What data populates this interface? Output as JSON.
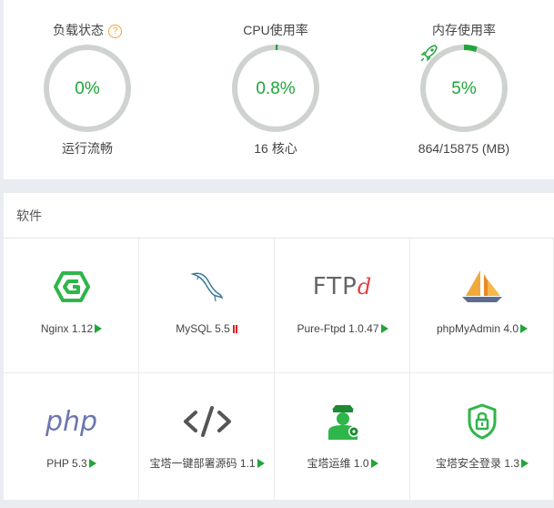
{
  "gauges": [
    {
      "title": "负载状态",
      "value_text": "0%",
      "percent": 0,
      "subtitle": "运行流畅",
      "help_icon": "help-icon"
    },
    {
      "title": "CPU使用率",
      "value_text": "0.8%",
      "percent": 0.8,
      "subtitle": "16 核心"
    },
    {
      "title": "内存使用率",
      "value_text": "5%",
      "percent": 5,
      "subtitle": "864/15875 (MB)",
      "icon": "rocket-icon"
    }
  ],
  "colors": {
    "accent": "#20a53a",
    "ring": "#cfd3cf",
    "stopped": "#e02020",
    "help": "#f0a22f"
  },
  "software": {
    "header": "软件",
    "items": [
      {
        "name": "Nginx 1.12",
        "status": "running",
        "icon": "nginx-icon"
      },
      {
        "name": "MySQL 5.5",
        "status": "stopped",
        "icon": "mysql-dolphin-icon"
      },
      {
        "name": "Pure-Ftpd 1.0.47",
        "status": "running",
        "icon": "ftp-icon",
        "logo_text": "FTP",
        "logo_d": "d"
      },
      {
        "name": "phpMyAdmin 4.0",
        "status": "running",
        "icon": "phpmyadmin-sailboat-icon"
      },
      {
        "name": "PHP 5.3",
        "status": "running",
        "icon": "php-icon",
        "logo_text": "php"
      },
      {
        "name": "宝塔一键部署源码 1.1",
        "status": "running",
        "icon": "code-icon"
      },
      {
        "name": "宝塔运维 1.0",
        "status": "running",
        "icon": "ops-person-icon"
      },
      {
        "name": "宝塔安全登录 1.3",
        "status": "running",
        "icon": "secure-lock-icon"
      }
    ]
  }
}
